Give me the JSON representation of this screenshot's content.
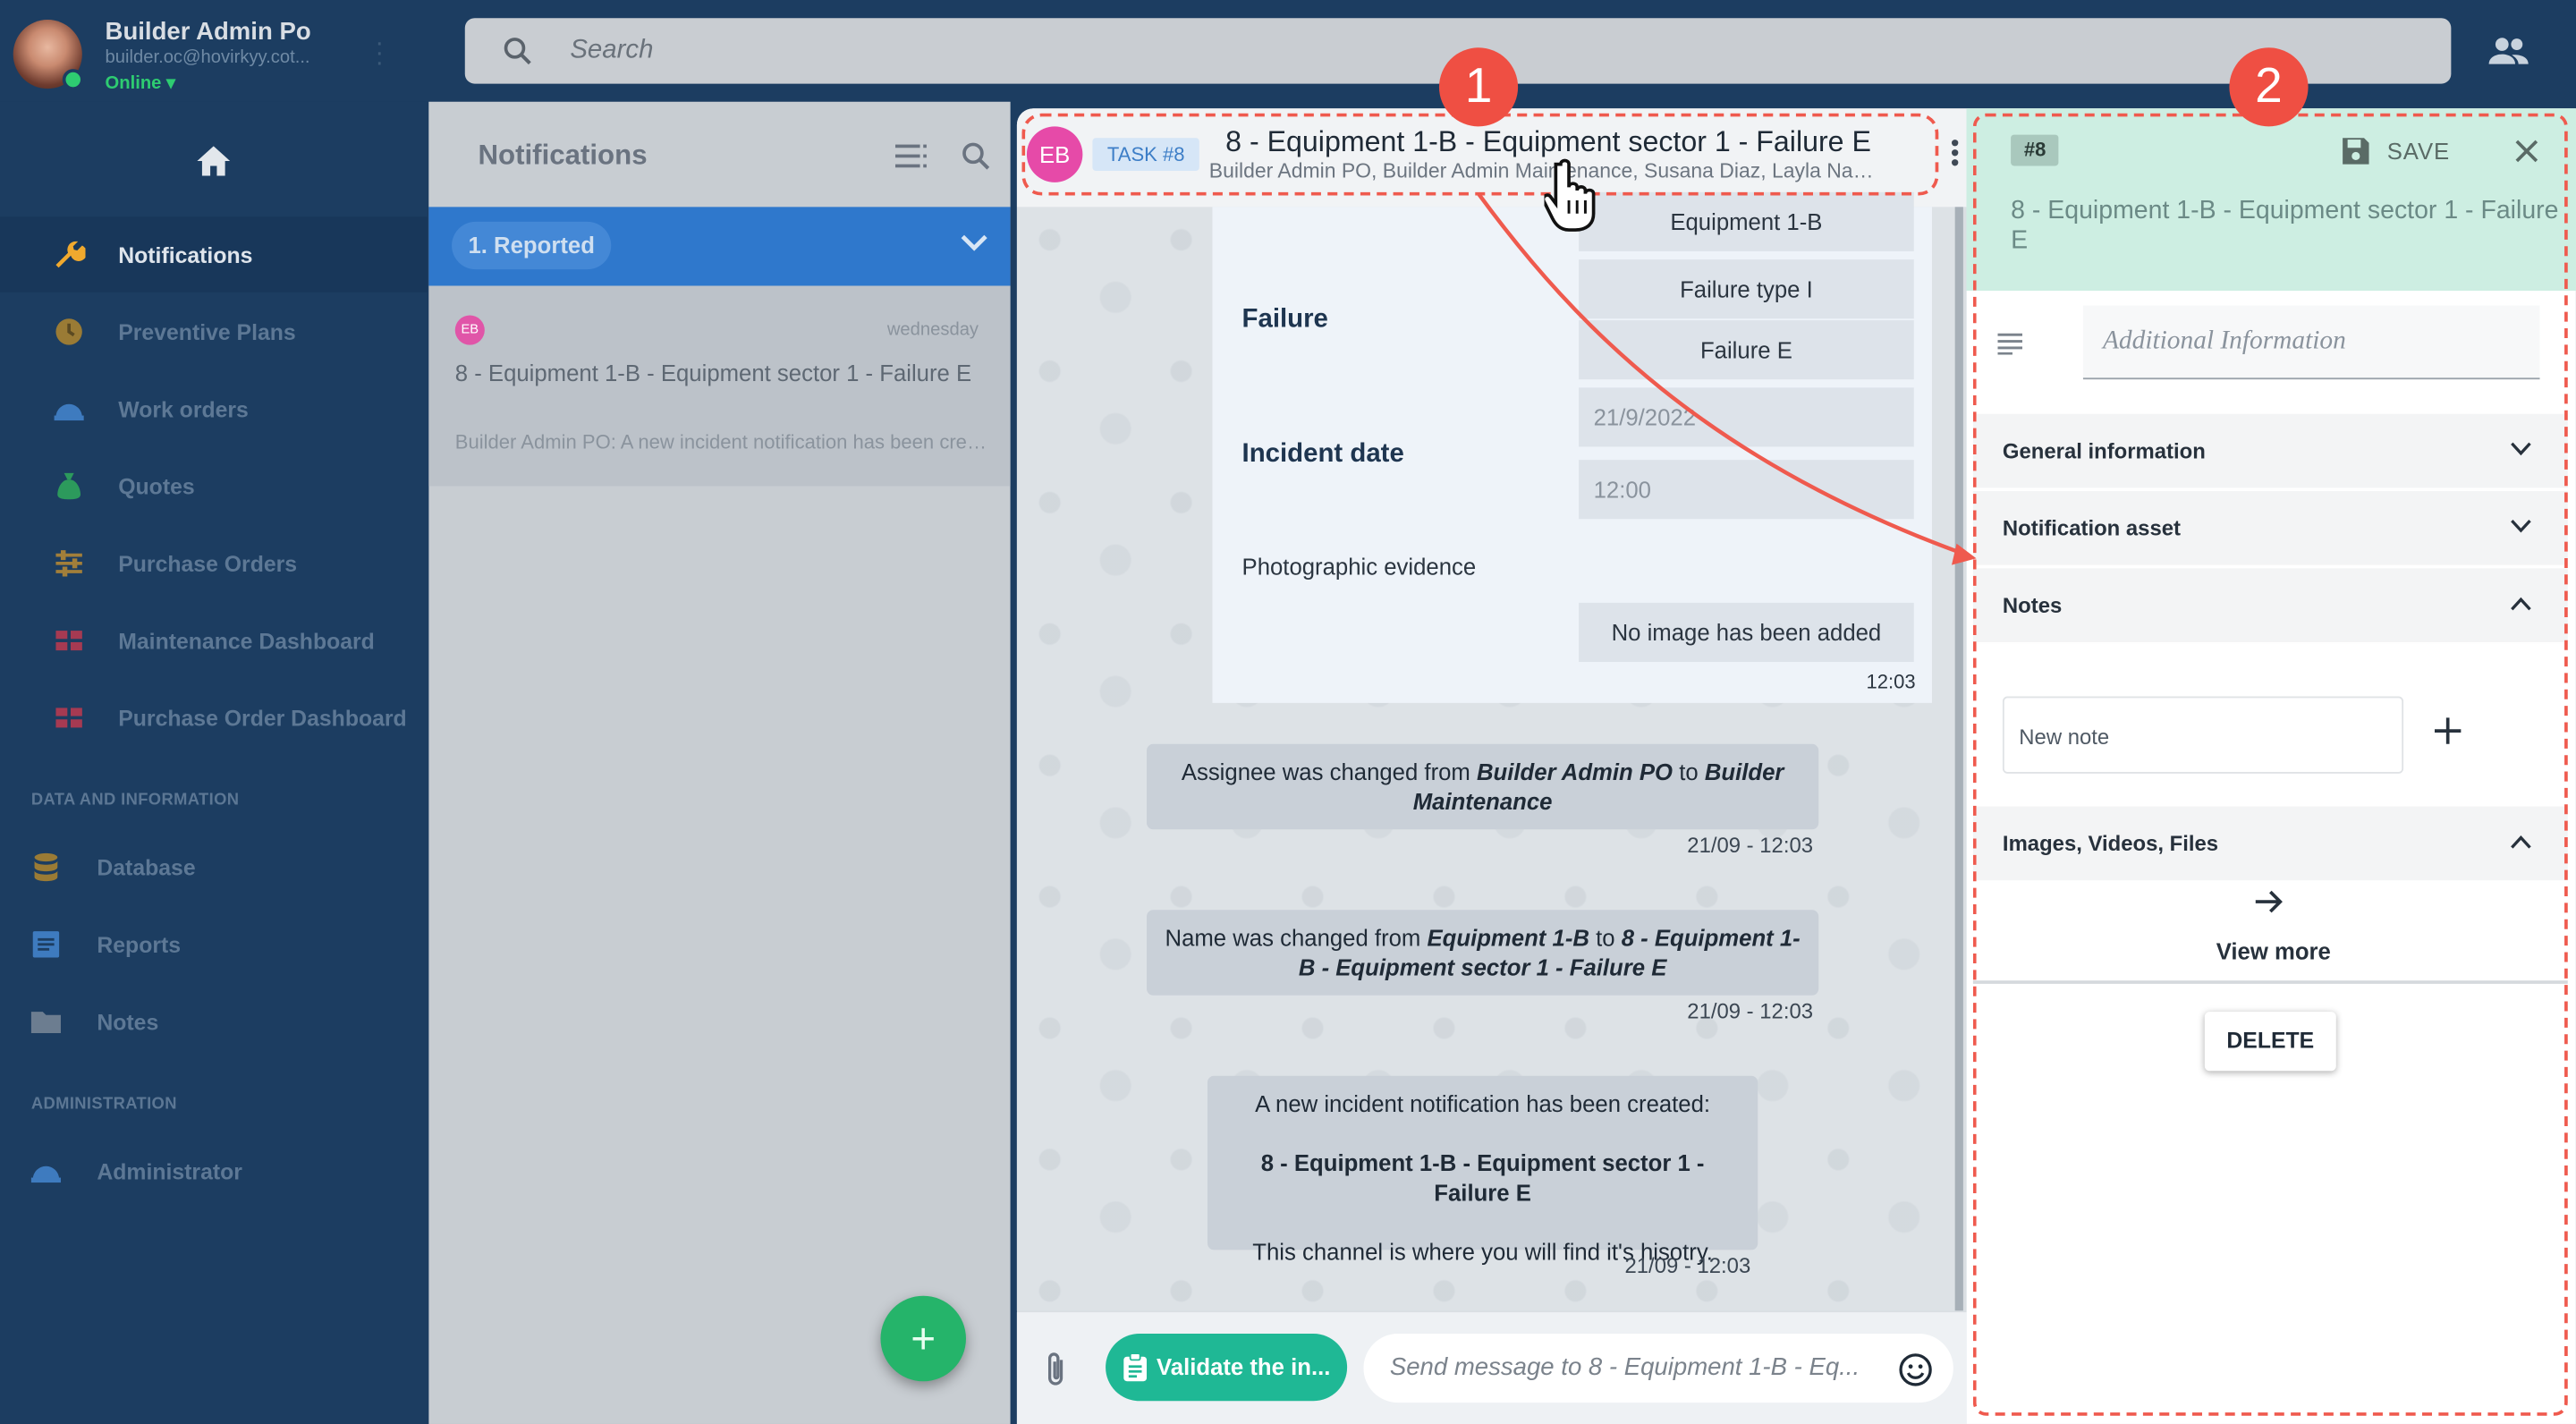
{
  "user": {
    "name": "Builder Admin Po",
    "email": "builder.oc@hovirkyy.cot...",
    "status": "Online"
  },
  "search": {
    "placeholder": "Search"
  },
  "sidebar": {
    "items": [
      {
        "label": "Notifications",
        "icon": "wrench-icon"
      },
      {
        "label": "Preventive Plans",
        "icon": "clock-icon"
      },
      {
        "label": "Work orders",
        "icon": "helmet-icon"
      },
      {
        "label": "Quotes",
        "icon": "money-bag-icon"
      },
      {
        "label": "Purchase Orders",
        "icon": "sliders-icon"
      },
      {
        "label": "Maintenance Dashboard",
        "icon": "dashboard-icon"
      },
      {
        "label": "Purchase Order Dashboard",
        "icon": "dashboard-icon"
      }
    ],
    "section_data": "DATA AND INFORMATION",
    "data_items": [
      {
        "label": "Database",
        "icon": "database-icon"
      },
      {
        "label": "Reports",
        "icon": "report-icon"
      },
      {
        "label": "Notes",
        "icon": "folder-icon"
      }
    ],
    "section_admin": "ADMINISTRATION",
    "admin_items": [
      {
        "label": "Administrator",
        "icon": "admin-icon"
      }
    ]
  },
  "notifications": {
    "title": "Notifications",
    "group": "1. Reported",
    "card": {
      "avatar": "EB",
      "day": "wednesday",
      "title": "8 - Equipment 1-B - Equipment sector 1 - Failure E",
      "preview": "Builder Admin PO: A new incident notification has been created"
    },
    "fab": "+"
  },
  "chat": {
    "avatar": "EB",
    "task": "TASK #8",
    "title": "8 - Equipment 1-B - Equipment sector 1 - Failure E",
    "members": "Builder Admin PO, Builder Admin Maintenance, Susana Diaz, Layla Nas...",
    "form": {
      "equipment": "Equipment 1-B",
      "failure_label": "Failure",
      "failure_type": "Failure type I",
      "failure": "Failure E",
      "incident_label": "Incident date",
      "date_ph": "21/9/2022",
      "time_ph": "12:00",
      "photo_label": "Photographic evidence",
      "no_image": "No image has been added",
      "time": "12:03"
    },
    "msg1": {
      "pre": "Assignee was changed from ",
      "from": "Builder Admin PO",
      "mid": " to ",
      "to": "Builder Maintenance",
      "time": "21/09 - 12:03"
    },
    "msg2": {
      "pre": "Name was changed from ",
      "from": "Equipment 1-B",
      "mid": " to ",
      "to": "8 -  Equipment 1-B - Equipment sector 1 - Failure E",
      "time": "21/09 - 12:03"
    },
    "msg3": {
      "line1": "A new incident notification has been created:",
      "line2": "8 -  Equipment 1-B - Equipment sector 1 - Failure E",
      "line3": "This channel is where you will find it's hisotry.",
      "time": "21/09 - 12:03"
    },
    "validate_label": "Validate the in...",
    "input_placeholder": "Send message to 8 - Equipment 1-B - Eq..."
  },
  "detail": {
    "badge": "#8",
    "save": "SAVE",
    "title": "8 - Equipment 1-B - Equipment sector 1 - Failure E",
    "additional_placeholder": "Additional Information",
    "sections": [
      "General information",
      "Notification asset",
      "Notes",
      "Images, Videos, Files"
    ],
    "new_note_placeholder": "New note",
    "view_more": "View more",
    "delete": "DELETE"
  },
  "annotations": {
    "one": "1",
    "two": "2"
  },
  "colors": {
    "sidebar": "#1c3d61",
    "accent": "#2f78cc",
    "validate": "#1fb895",
    "annotation": "#ef4f43",
    "detail_header": "#cdeee2"
  }
}
